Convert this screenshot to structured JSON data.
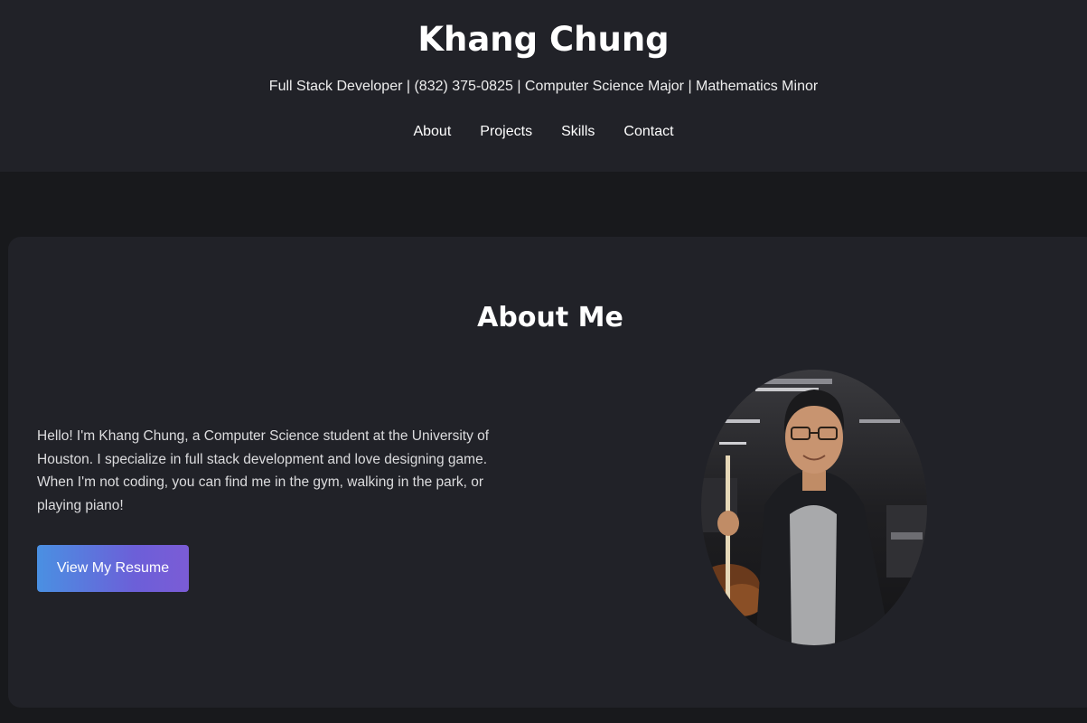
{
  "header": {
    "title": "Khang Chung",
    "subtitle": "Full Stack Developer | (832) 375-0825 | Computer Science Major | Mathematics Minor"
  },
  "nav": {
    "items": [
      {
        "label": "About"
      },
      {
        "label": "Projects"
      },
      {
        "label": "Skills"
      },
      {
        "label": "Contact"
      }
    ]
  },
  "about": {
    "heading": "About Me",
    "text": "Hello! I'm Khang Chung, a Computer Science student at the University of Houston. I specialize in full stack development and love designing game. When I'm not coding, you can find me in the gym, walking in the park, or playing piano!",
    "resume_button": "View My Resume",
    "photo": "profile-photo"
  },
  "colors": {
    "page_background": "#18191c",
    "panel_background": "#212228",
    "button_gradient_start": "#4a90e2",
    "button_gradient_end": "#7b5cd6"
  }
}
